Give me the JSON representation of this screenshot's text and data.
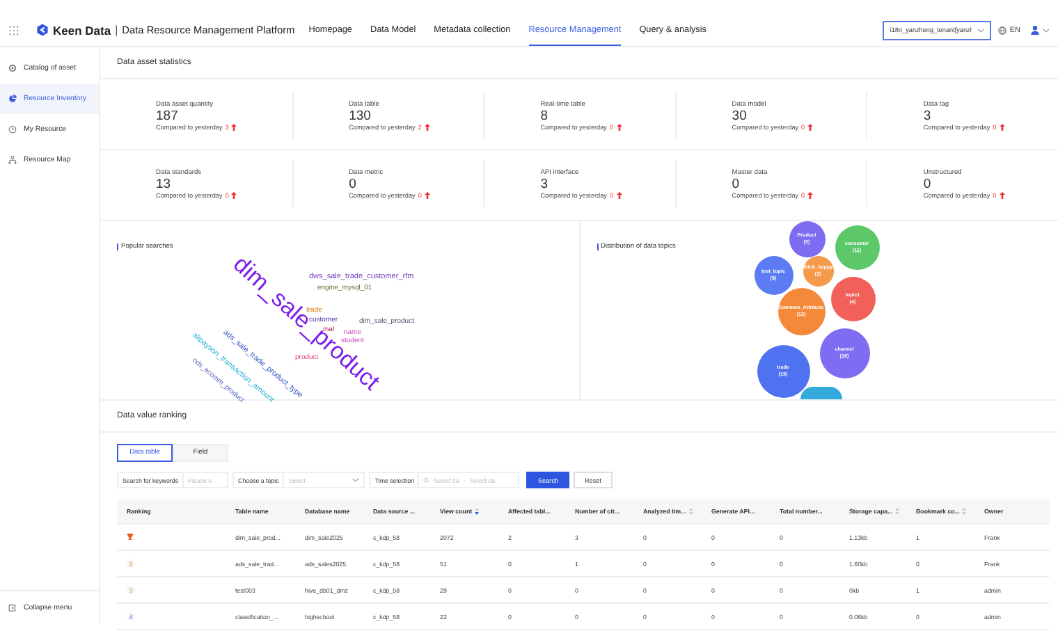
{
  "header": {
    "brand": "Keen Data",
    "separator": "|",
    "platform": "Data Resource Management Platform",
    "nav": [
      {
        "label": "Homepage",
        "selected": false
      },
      {
        "label": "Data Model",
        "selected": false
      },
      {
        "label": "Metadata collection",
        "selected": false
      },
      {
        "label": "Resource Management",
        "selected": true
      },
      {
        "label": "Query & analysis",
        "selected": false
      }
    ],
    "tenant": "i18n_yanzheng_tenant[yanzl",
    "language": "EN"
  },
  "sidebar": {
    "items": [
      {
        "label": "Catalog of asset",
        "selected": false
      },
      {
        "label": "Resource Inventory",
        "selected": true
      },
      {
        "label": "My Resource",
        "selected": false
      },
      {
        "label": "Resource Map",
        "selected": false
      }
    ],
    "collapse": "Collapse menu"
  },
  "statistics": {
    "title": "Data asset statistics",
    "rows": [
      [
        {
          "label": "Data asset quantity",
          "value": "187",
          "compare": "Compared to yesterday",
          "delta": "3"
        },
        {
          "label": "Data table",
          "value": "130",
          "compare": "Compared to yesterday",
          "delta": "2"
        },
        {
          "label": "Real-time table",
          "value": "8",
          "compare": "Compared to yesterday",
          "delta": "0"
        },
        {
          "label": "Data model",
          "value": "30",
          "compare": "Compared to yesterday",
          "delta": "0"
        },
        {
          "label": "Data tag",
          "value": "3",
          "compare": "Compared to yesterday",
          "delta": "0"
        }
      ],
      [
        {
          "label": "Data standards",
          "value": "13",
          "compare": "Compared to yesterday",
          "delta": "0"
        },
        {
          "label": "Data metric",
          "value": "0",
          "compare": "Compared to yesterday",
          "delta": "0"
        },
        {
          "label": "API interface",
          "value": "3",
          "compare": "Compared to yesterday",
          "delta": "0"
        },
        {
          "label": "Master data",
          "value": "0",
          "compare": "Compared to yesterday",
          "delta": "0"
        },
        {
          "label": "Unstructured",
          "value": "0",
          "compare": "Compared to yesterday",
          "delta": "0"
        }
      ]
    ]
  },
  "popular_searches": {
    "title": "Popular searches",
    "words": [
      "dim_sale_product",
      "dws_sale_trade_customer_rfm",
      "engine_mysql_01",
      "trade",
      "customer",
      "dim_sale_product",
      "name",
      "student",
      "ads_sale_trade_product_type",
      "alipayson_transaction_amount",
      "ods_ecomm_product",
      "product",
      "mal"
    ]
  },
  "data_topics": {
    "title": "Distribution of data topics",
    "bubbles": [
      {
        "name": "Product",
        "count": "(5)",
        "color": "#7b6cf0"
      },
      {
        "name": "consumer",
        "count": "(11)",
        "color": "#5cc86a"
      },
      {
        "name": "test_topic",
        "count": "(8)",
        "color": "#5b7cf2"
      },
      {
        "name": "drink_happy",
        "count": "(2)",
        "color": "#f59a4a"
      },
      {
        "name": "topic1",
        "count": "(4)",
        "color": "#f2605a"
      },
      {
        "name": "Common_Attribute",
        "count": "(13)",
        "color": "#f5893a"
      },
      {
        "name": "channel",
        "count": "(16)",
        "color": "#7e6cf2"
      },
      {
        "name": "trade",
        "count": "(19)",
        "color": "#4f72f0"
      }
    ]
  },
  "ranking": {
    "title": "Data value ranking",
    "tabs": [
      {
        "label": "Data table",
        "selected": true
      },
      {
        "label": "Field",
        "selected": false
      }
    ],
    "filters": {
      "keyword_label": "Search for keywords",
      "keyword_placeholder": "Please e",
      "topic_label": "Choose a topic",
      "topic_placeholder": "Select",
      "time_label": "Time selection",
      "start_placeholder": "Select da",
      "range_separator": "-",
      "end_placeholder": "Select da",
      "search": "Search",
      "reset": "Reset"
    },
    "columns": [
      {
        "label": "Ranking",
        "sortable": false
      },
      {
        "label": "Table name",
        "sortable": false
      },
      {
        "label": "Database name",
        "sortable": false
      },
      {
        "label": "Data source ...",
        "sortable": false
      },
      {
        "label": "View count",
        "sortable": true,
        "sorted": true
      },
      {
        "label": "Affected tabl...",
        "sortable": false
      },
      {
        "label": "Number of cit...",
        "sortable": false
      },
      {
        "label": "Analyzed tim...",
        "sortable": true,
        "sorted": false
      },
      {
        "label": "Generate API...",
        "sortable": false
      },
      {
        "label": "Total number...",
        "sortable": false
      },
      {
        "label": "Storage capa...",
        "sortable": true,
        "sorted": false
      },
      {
        "label": "Bookmark co...",
        "sortable": true,
        "sorted": false
      },
      {
        "label": "Owner",
        "sortable": false
      }
    ],
    "rows": [
      {
        "cells": [
          {
            "kind": "trophy"
          },
          "dim_sale_prod...",
          "dim_sale2025",
          "c_kdp_58",
          "2072",
          "2",
          "3",
          "0",
          "0",
          "0",
          "1.13kb",
          "1",
          "Frank"
        ]
      },
      {
        "cells": [
          {
            "kind": "top",
            "text": "2"
          },
          "ads_sale_trad...",
          "ads_sales2025",
          "c_kdp_58",
          "51",
          "0",
          "1",
          "0",
          "0",
          "0",
          "1.60kb",
          "0",
          "Frank"
        ]
      },
      {
        "cells": [
          {
            "kind": "top",
            "text": "3"
          },
          "test003",
          "hive_db01_dmz",
          "c_kdp_58",
          "29",
          "0",
          "0",
          "0",
          "0",
          "0",
          "0kb",
          "1",
          "admin"
        ]
      },
      {
        "cells": [
          {
            "kind": "plain",
            "text": "4"
          },
          "classification_...",
          "highschool",
          "c_kdp_58",
          "22",
          "0",
          "0",
          "0",
          "0",
          "0",
          "0.06kb",
          "0",
          "admin"
        ]
      }
    ]
  }
}
